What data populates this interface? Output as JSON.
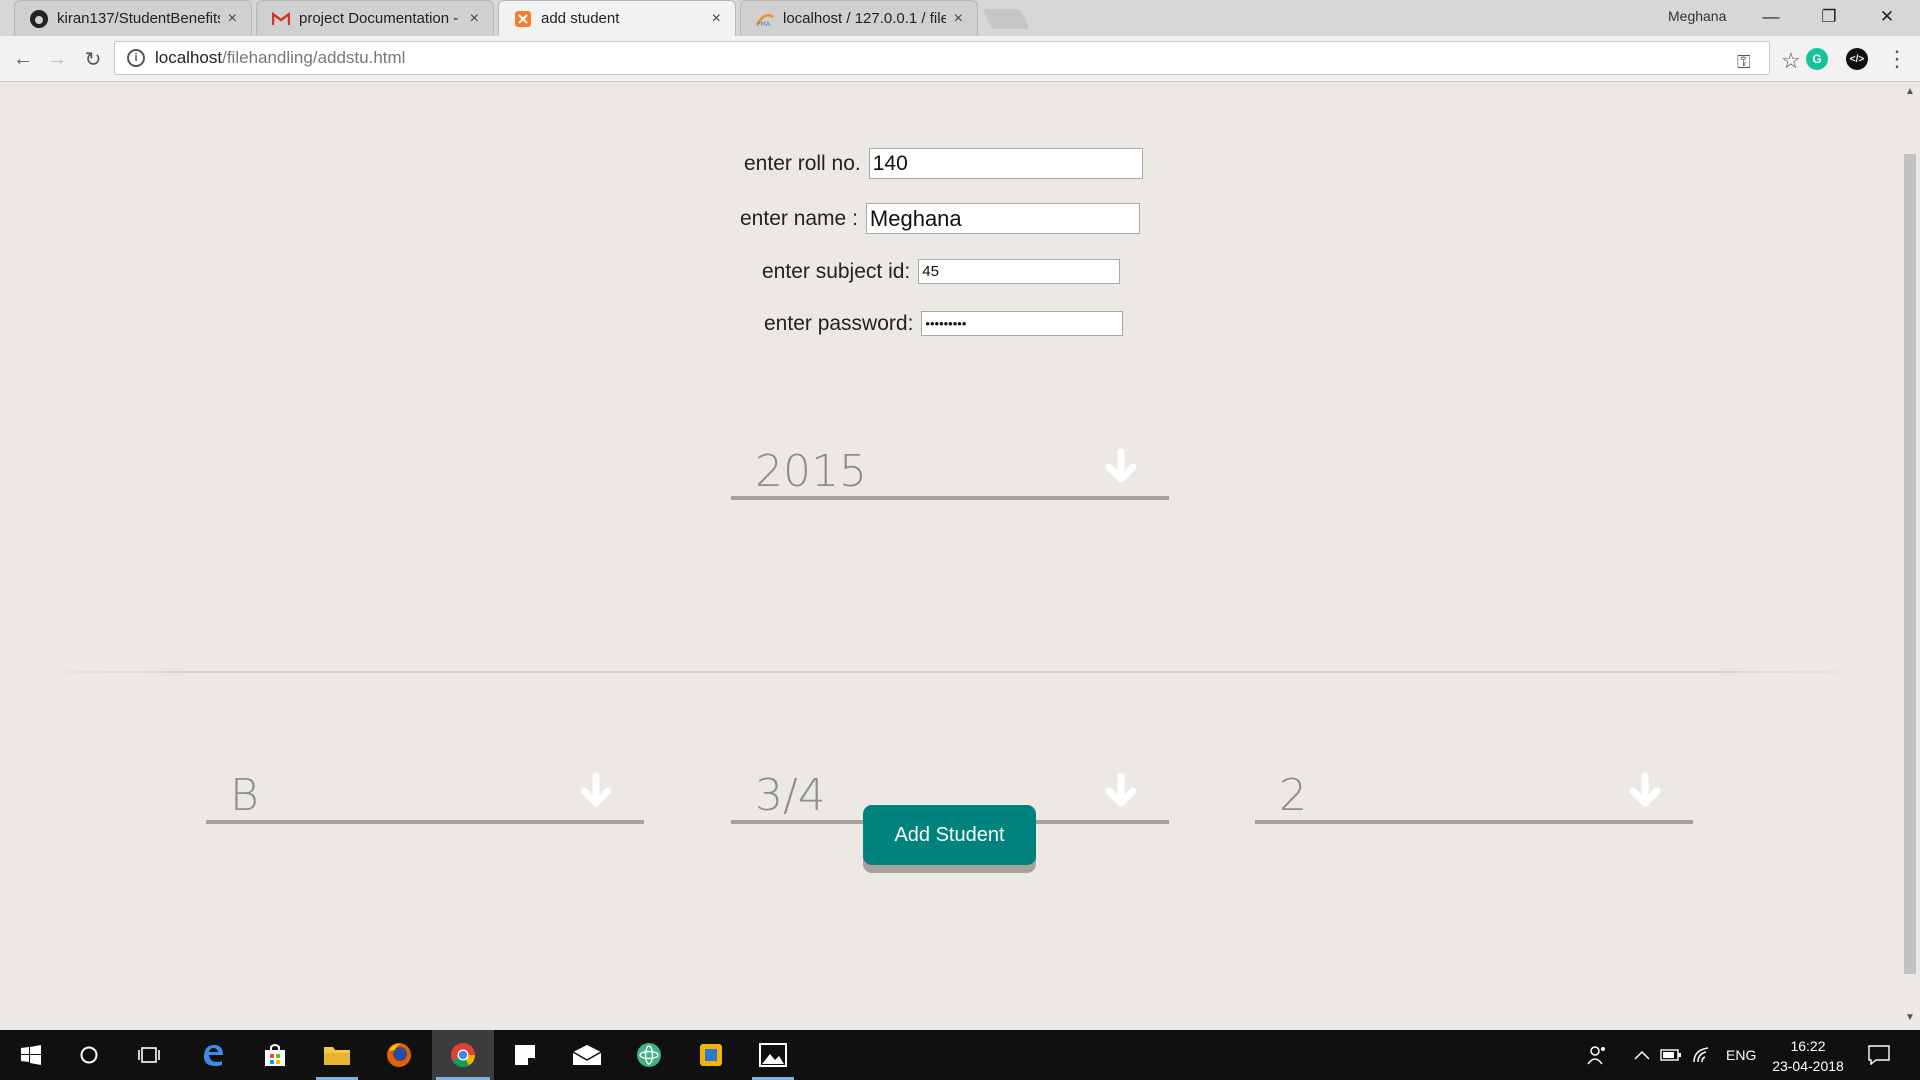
{
  "browser": {
    "tabs": [
      {
        "title": "kiran137/StudentBenefits",
        "icon": "github-icon"
      },
      {
        "title": "project Documentation -",
        "icon": "gmail-icon"
      },
      {
        "title": "add student",
        "icon": "xampp-icon",
        "active": true
      },
      {
        "title": "localhost / 127.0.0.1 / file",
        "icon": "phpmyadmin-icon"
      }
    ],
    "close_glyph": "×",
    "user": "Meghana",
    "url_host": "localhost",
    "url_path": "/filehandling/addstu.html"
  },
  "form": {
    "roll_label": "enter roll no.",
    "roll_value": "140",
    "name_label": "enter name :",
    "name_value": "Meghana",
    "subject_label": "enter subject id:",
    "subject_value": "45",
    "password_label": "enter password:",
    "password_value": "•••••••••",
    "year_select": "2015",
    "section_select": "B",
    "semester_select": "3/4",
    "third_select": "2",
    "submit_label": "Add Student"
  },
  "taskbar": {
    "lang": "ENG",
    "time": "16:22",
    "date": "23-04-2018"
  },
  "colors": {
    "accent": "#00827e",
    "page_bg": "#ece9e5",
    "select_underline": "#a5a19c",
    "select_text": "#8b8e91"
  }
}
